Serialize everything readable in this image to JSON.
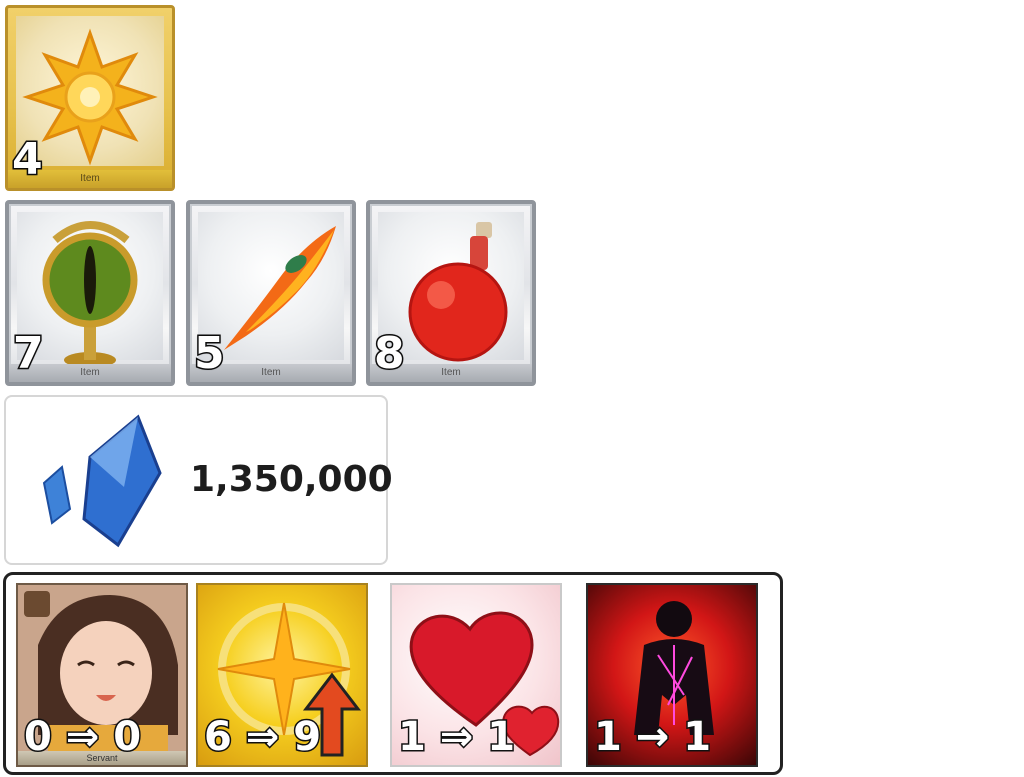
{
  "top_item": {
    "footer": "Item",
    "count": "4",
    "icon": "gold-star-crest-icon"
  },
  "items": [
    {
      "footer": "Item",
      "count": "7",
      "icon": "serpent-eye-icon"
    },
    {
      "footer": "Item",
      "count": "5",
      "icon": "phoenix-feather-icon"
    },
    {
      "footer": "Item",
      "count": "8",
      "icon": "red-potion-flask-icon"
    }
  ],
  "qp": {
    "amount": "1,350,000",
    "icon": "blue-crystal-icon"
  },
  "upgrades": [
    {
      "label": "0 ⇒ 0",
      "footer": "Servant",
      "icon": "servant-portrait-icon"
    },
    {
      "label": "6 ⇒ 9",
      "icon": "golden-compass-star-icon"
    },
    {
      "label": "1 ⇒ 1",
      "icon": "hearts-icon"
    },
    {
      "label": "1 → 1",
      "icon": "dark-silhouette-icon"
    }
  ],
  "colors": {
    "gold_frame": "#b9902a",
    "silver_frame": "#8f949b",
    "arrow_up": "#e34a1f"
  }
}
